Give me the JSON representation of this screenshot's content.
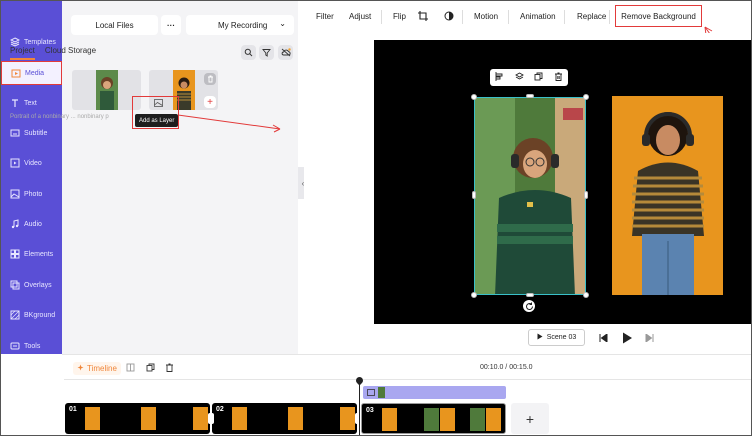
{
  "sidebar": {
    "items": [
      {
        "label": "Templates",
        "icon": "templates-icon"
      },
      {
        "label": "Media",
        "icon": "media-icon"
      },
      {
        "label": "Text",
        "icon": "text-icon"
      },
      {
        "label": "Subtitle",
        "icon": "subtitle-icon"
      },
      {
        "label": "Video",
        "icon": "video-icon"
      },
      {
        "label": "Photo",
        "icon": "photo-icon"
      },
      {
        "label": "Audio",
        "icon": "audio-icon"
      },
      {
        "label": "Elements",
        "icon": "elements-icon"
      },
      {
        "label": "Overlays",
        "icon": "overlays-icon"
      },
      {
        "label": "BKground",
        "icon": "background-icon"
      },
      {
        "label": "Tools",
        "icon": "tools-icon"
      }
    ]
  },
  "media": {
    "local_files": "Local Files",
    "more": "···",
    "recording": "My Recording",
    "tabs": [
      "Project",
      "Cloud Storage"
    ],
    "caption": "Portrait of a nonbinary ... nonbinary p",
    "tooltip": "Add as Layer",
    "add_symbol": "+"
  },
  "toolbar": {
    "items": [
      "Filter",
      "Adjust",
      "Flip",
      "Motion",
      "Animation",
      "Replace",
      "Remove Background"
    ]
  },
  "player": {
    "scene": "Scene 03"
  },
  "timeline": {
    "label": "Timeline",
    "time": "00:10.0 / 00:15.0",
    "clips": [
      "01",
      "02",
      "03"
    ],
    "add": "+"
  },
  "colors": {
    "accent": "#5a4fd6",
    "highlight": "#e23a3a",
    "orange": "#f0863a"
  }
}
